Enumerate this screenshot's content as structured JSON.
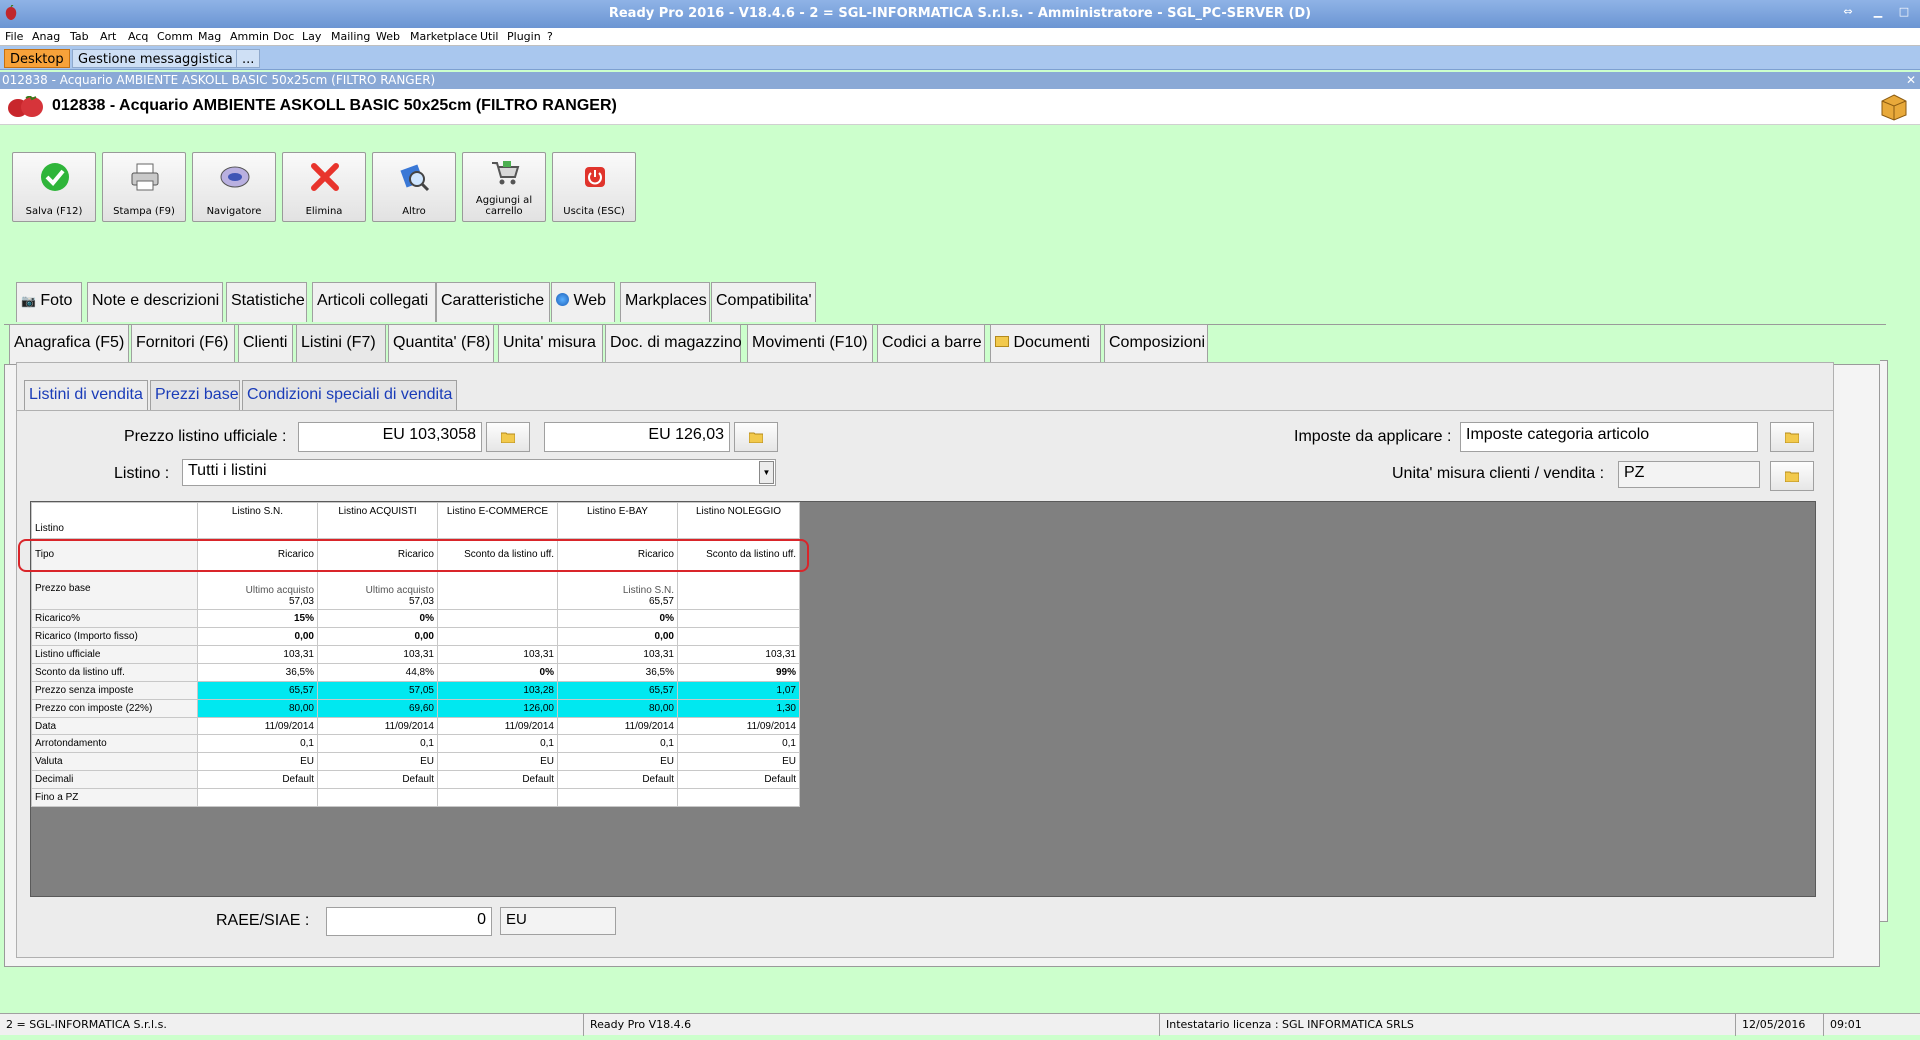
{
  "window": {
    "title": "Ready Pro 2016 - V18.4.6 - 2 = SGL-INFORMATICA S.r.l.s. - Amministratore - SGL_PC-SERVER (D)"
  },
  "menu": [
    "File",
    "Anag",
    "Tab",
    "Art",
    "Acq",
    "Comm",
    "Mag",
    "Ammin",
    "Doc",
    "Lay",
    "Mailing",
    "Web",
    "Marketplace",
    "Util",
    "Plugin",
    "?"
  ],
  "desktop_tabs": {
    "desktop": "Desktop",
    "gestione": "Gestione messaggistica",
    "more": "..."
  },
  "inner_window": {
    "caption": "012838 - Acquario AMBIENTE ASKOLL BASIC 50x25cm (FILTRO RANGER)"
  },
  "header": {
    "title": "012838 - Acquario AMBIENTE ASKOLL BASIC 50x25cm (FILTRO RANGER)"
  },
  "toolbar": {
    "save": "Salva (F12)",
    "print": "Stampa (F9)",
    "navigator": "Navigatore",
    "delete": "Elimina",
    "other": "Altro",
    "add_cart_1": "Aggiungi al",
    "add_cart_2": "carrello",
    "exit": "Uscita (ESC)"
  },
  "tabs_row1": [
    "Foto",
    "Note e descrizioni",
    "Statistiche",
    "Articoli collegati",
    "Caratteristiche",
    "Web",
    "Markplaces",
    "Compatibilita'"
  ],
  "tabs_row2": [
    "Anagrafica (F5)",
    "Fornitori (F6)",
    "Clienti",
    "Listini (F7)",
    "Quantita' (F8)",
    "Unita' misura",
    "Doc. di magazzino",
    "Movimenti (F10)",
    "Codici a barre",
    "Documenti",
    "Composizioni"
  ],
  "subtabs": [
    "Listini di vendita",
    "Prezzi base",
    "Condizioni speciali di vendita"
  ],
  "form": {
    "prezzo_label": "Prezzo listino ufficiale :",
    "prezzo_value": "EU 103,3058",
    "prezzo_ivato": "EU 126,03",
    "listino_label": "Listino :",
    "listino_value": "Tutti i listini",
    "imposte_label": "Imposte da applicare :",
    "imposte_value": "Imposte categoria articolo",
    "um_label": "Unita' misura clienti / vendita :",
    "um_value": "PZ",
    "raee_label": "RAEE/SIAE :",
    "raee_value": "0",
    "raee_currency": "EU"
  },
  "grid": {
    "corner": "Listino",
    "columns": [
      "Listino S.N.",
      "Listino ACQUISTI",
      "Listino E-COMMERCE",
      "Listino E-BAY",
      "Listino NOLEGGIO"
    ],
    "tipo": {
      "label": "Tipo",
      "values": [
        "Ricarico",
        "Ricarico",
        "Sconto da listino uff.",
        "Ricarico",
        "Sconto da listino uff."
      ]
    },
    "prezzo_base": {
      "label": "Prezzo base",
      "sub": [
        "Ultimo acquisto",
        "Ultimo acquisto",
        "",
        "Listino S.N.",
        ""
      ],
      "values": [
        "57,03",
        "57,03",
        "",
        "65,57",
        ""
      ]
    },
    "rows": [
      {
        "label": "Ricarico%",
        "values": [
          "15%",
          "0%",
          "",
          "0%",
          ""
        ],
        "bold": [
          true,
          true,
          false,
          true,
          false
        ],
        "cyan": false
      },
      {
        "label": "Ricarico (Importo fisso)",
        "values": [
          "0,00",
          "0,00",
          "",
          "0,00",
          ""
        ],
        "bold": [
          true,
          true,
          false,
          true,
          false
        ],
        "cyan": false
      },
      {
        "label": "Listino ufficiale",
        "values": [
          "103,31",
          "103,31",
          "103,31",
          "103,31",
          "103,31"
        ],
        "bold": [
          false,
          false,
          false,
          false,
          false
        ],
        "cyan": false
      },
      {
        "label": "Sconto da listino uff.",
        "values": [
          "36,5%",
          "44,8%",
          "0%",
          "36,5%",
          "99%"
        ],
        "bold": [
          false,
          false,
          true,
          false,
          true
        ],
        "cyan": false
      },
      {
        "label": "Prezzo senza imposte",
        "values": [
          "65,57",
          "57,05",
          "103,28",
          "65,57",
          "1,07"
        ],
        "bold": [
          false,
          false,
          false,
          false,
          false
        ],
        "cyan": true
      },
      {
        "label": "Prezzo con imposte (22%)",
        "values": [
          "80,00",
          "69,60",
          "126,00",
          "80,00",
          "1,30"
        ],
        "bold": [
          false,
          false,
          false,
          false,
          false
        ],
        "cyan": true
      },
      {
        "label": "Data",
        "values": [
          "11/09/2014",
          "11/09/2014",
          "11/09/2014",
          "11/09/2014",
          "11/09/2014"
        ],
        "bold": [
          false,
          false,
          false,
          false,
          false
        ],
        "cyan": false
      },
      {
        "label": "Arrotondamento",
        "values": [
          "0,1",
          "0,1",
          "0,1",
          "0,1",
          "0,1"
        ],
        "bold": [
          false,
          false,
          false,
          false,
          false
        ],
        "cyan": false
      },
      {
        "label": "Valuta",
        "values": [
          "EU",
          "EU",
          "EU",
          "EU",
          "EU"
        ],
        "bold": [
          false,
          false,
          false,
          false,
          false
        ],
        "cyan": false
      },
      {
        "label": "Decimali",
        "values": [
          "Default",
          "Default",
          "Default",
          "Default",
          "Default"
        ],
        "bold": [
          false,
          false,
          false,
          false,
          false
        ],
        "cyan": false
      },
      {
        "label": "Fino a PZ",
        "values": [
          "",
          "",
          "",
          "",
          ""
        ],
        "bold": [
          false,
          false,
          false,
          false,
          false
        ],
        "cyan": false
      }
    ]
  },
  "statusbar": {
    "company": "2 = SGL-INFORMATICA S.r.l.s.",
    "version": "Ready Pro V18.4.6",
    "license": "Intestatario licenza : SGL INFORMATICA SRLS",
    "date": "12/05/2016",
    "time": "09:01"
  },
  "colors": {
    "background": "#ccffcc",
    "titlebar": "#6b95d3",
    "highlight_cells": "#00e8f0",
    "annotation": "#d9252a"
  }
}
